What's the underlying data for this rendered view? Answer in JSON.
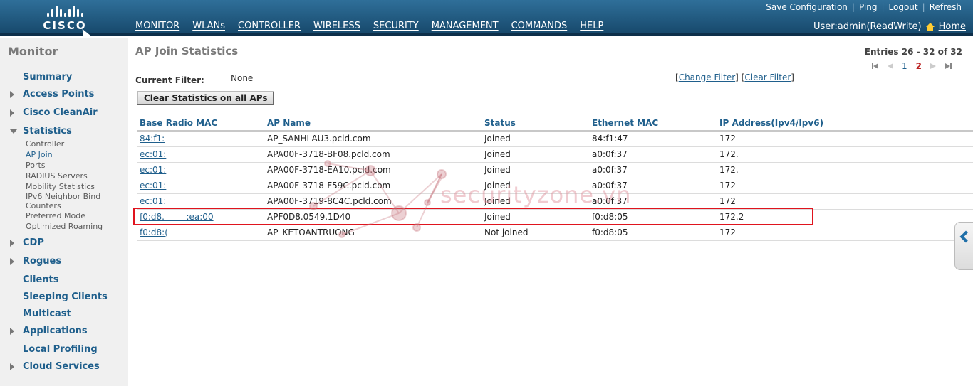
{
  "brand": {
    "logo_text": "CISCO"
  },
  "top_links": [
    "Save Configuration",
    "Ping",
    "Logout",
    "Refresh"
  ],
  "nav": {
    "items": [
      "MONITOR",
      "WLANs",
      "CONTROLLER",
      "WIRELESS",
      "SECURITY",
      "MANAGEMENT",
      "COMMANDS",
      "HELP"
    ],
    "active": "MONITOR"
  },
  "user": {
    "label": "User:admin(ReadWrite)",
    "home": "Home"
  },
  "sidebar": {
    "title": "Monitor",
    "items": [
      {
        "label": "Summary",
        "arrow": ""
      },
      {
        "label": "Access Points",
        "arrow": "right"
      },
      {
        "label": "Cisco CleanAir",
        "arrow": "right"
      },
      {
        "label": "Statistics",
        "arrow": "down"
      },
      {
        "label": "CDP",
        "arrow": "right"
      },
      {
        "label": "Rogues",
        "arrow": "right"
      },
      {
        "label": "Clients",
        "arrow": ""
      },
      {
        "label": "Sleeping Clients",
        "arrow": ""
      },
      {
        "label": "Multicast",
        "arrow": ""
      },
      {
        "label": "Applications",
        "arrow": "right"
      },
      {
        "label": "Local Profiling",
        "arrow": ""
      },
      {
        "label": "Cloud Services",
        "arrow": "right"
      }
    ],
    "statistics_sub": [
      "Controller",
      "AP Join",
      "Ports",
      "RADIUS Servers",
      "Mobility Statistics",
      "IPv6 Neighbor Bind Counters",
      "Preferred Mode",
      "Optimized Roaming"
    ],
    "active_sub": "AP Join"
  },
  "page": {
    "title": "AP Join Statistics",
    "entries": "Entries 26 - 32 of 32",
    "pages": [
      "1",
      "2"
    ],
    "current_page": "2",
    "filter_label": "Current Filter:",
    "filter_value": "None",
    "change_filter": "Change Filter",
    "clear_filter": "Clear Filter",
    "clear_button": "Clear Statistics on all APs"
  },
  "table": {
    "columns": [
      "Base Radio MAC",
      "AP Name",
      "Status",
      "Ethernet MAC",
      "IP Address(Ipv4/Ipv6)"
    ],
    "rows": [
      [
        "84:f1:",
        "AP_SANHLAU3.pcld.com",
        "Joined",
        "84:f1:47",
        "172"
      ],
      [
        "ec:01:",
        "APA00F-3718-BF08.pcld.com",
        "Joined",
        "a0:0f:37",
        "172."
      ],
      [
        "ec:01:",
        "APA00F-3718-EA10.pcld.com",
        "Joined",
        "a0:0f:37",
        "172."
      ],
      [
        "ec:01:",
        "APA00F-3718-F59C.pcld.com",
        "Joined",
        "a0:0f:37",
        "172"
      ],
      [
        "ec:01:",
        "APA00F-3719-8C4C.pcld.com",
        "Joined",
        "a0:0f:37",
        "172"
      ],
      [
        "f0:d8.        :ea:00",
        "APF0D8.0549.1D40",
        "Joined",
        "f0:d8:05",
        "172.2"
      ],
      [
        "f0:d8:(",
        "AP_KETOANTRUONG",
        "Not joined",
        "f0:d8:05",
        "172"
      ]
    ],
    "highlighted_row": 5
  },
  "watermark": "securityzone.vn"
}
